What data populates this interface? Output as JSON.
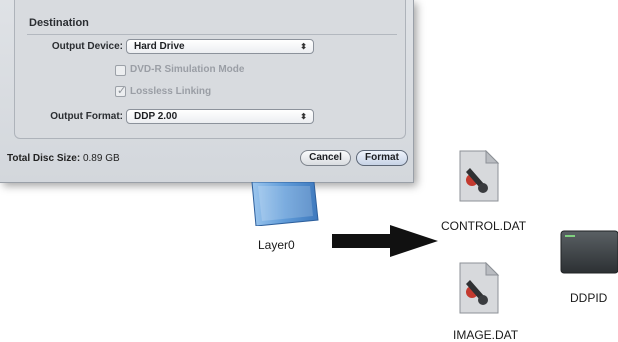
{
  "dialog": {
    "group_title": "Destination",
    "output_device_label": "Output Device:",
    "output_device_value": "Hard Drive",
    "dvd_sim_label": "DVD-R Simulation Mode",
    "dvd_sim_checked": false,
    "lossless_label": "Lossless Linking",
    "lossless_checked": true,
    "output_format_label": "Output Format:",
    "output_format_value": "DDP 2.00",
    "popup_arrows": "⬍",
    "total_label": "Total Disc Size:",
    "total_value": "0.89 GB",
    "cancel_label": "Cancel",
    "format_label": "Format"
  },
  "desktop": {
    "folder_label": "Layer0",
    "control_label": "CONTROL.DAT",
    "image_label": "IMAGE.DAT",
    "ddpid_label": "DDPID"
  },
  "colors": {
    "arrow": "#111111",
    "folder": "#6aa2dc",
    "dark_icon": "#3d4245"
  }
}
